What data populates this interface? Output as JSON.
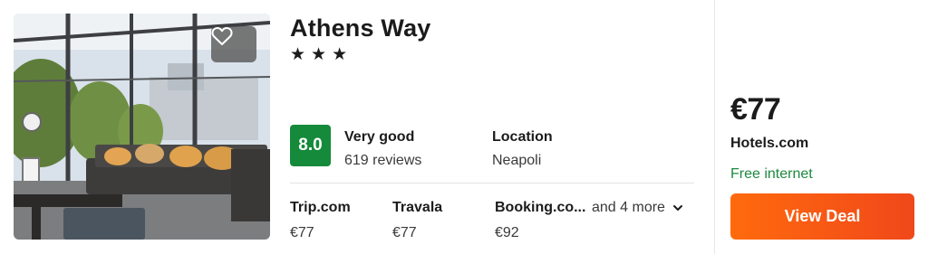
{
  "hotel": {
    "name": "Athens Way",
    "star_rating": 3,
    "stars": [
      "★",
      "★",
      "★"
    ]
  },
  "rating": {
    "score": "8.0",
    "label": "Very good",
    "reviews": "619 reviews",
    "badge_color": "#158a3a"
  },
  "location": {
    "label": "Location",
    "value": "Neapoli"
  },
  "providers": [
    {
      "name": "Trip.com",
      "price": "€77"
    },
    {
      "name": "Travala",
      "price": "€77"
    },
    {
      "name": "Booking.co...",
      "price": "€92"
    }
  ],
  "more_providers": "and 4 more",
  "deal": {
    "price": "€77",
    "site": "Hotels.com",
    "amenity": "Free internet",
    "button_label": "View Deal",
    "button_color": "#ff6a0d",
    "amenity_color": "#1e8a3e"
  },
  "icons": {
    "favorite": "heart-outline-icon",
    "more": "chevron-down-icon",
    "star": "star-icon"
  }
}
